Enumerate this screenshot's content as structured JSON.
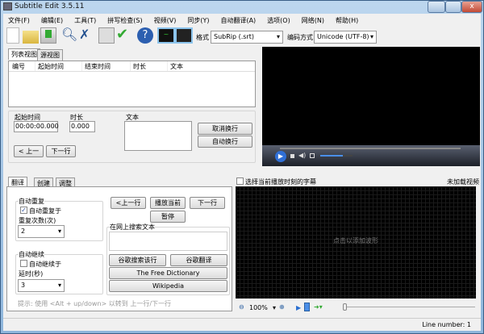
{
  "window": {
    "title": "Subtitle Edit 3.5.11"
  },
  "menu": [
    "文件(F)",
    "编辑(E)",
    "工具(T)",
    "拼写检查(S)",
    "视频(V)",
    "同步(Y)",
    "自动翻译(A)",
    "选项(O)",
    "网络(N)",
    "帮助(H)"
  ],
  "toolbar": {
    "format_label": "格式",
    "format_value": "SubRip (.srt)",
    "encoding_label": "编码方式",
    "encoding_value": "Unicode (UTF-8)"
  },
  "list": {
    "tabs": [
      "列表视图",
      "源视图"
    ],
    "columns": [
      "编号",
      "起始时间",
      "结束时间",
      "时长",
      "文本"
    ]
  },
  "edit": {
    "start_label": "起始时间",
    "start_value": "00:00:00.000",
    "duration_label": "时长",
    "duration_value": "0.000",
    "text_label": "文本",
    "unbreak": "取消换行",
    "autobreak": "自动换行",
    "prev": "< 上一",
    "next": "下一行"
  },
  "bottom": {
    "tabs": [
      "翻译",
      "创建",
      "调整"
    ],
    "auto_repeat": {
      "title": "自动重复",
      "checkbox": "自动重复于",
      "count_label": "重复次数(次)",
      "count_value": "2"
    },
    "auto_continue": {
      "title": "自动继续",
      "checkbox": "自动继续于",
      "delay_label": "延时(秒)",
      "delay_value": "3"
    },
    "prev_line": "<上一行",
    "play_current": "播放当前",
    "next_line": "下一行",
    "pause": "暂停",
    "search_title": "在网上搜索文本",
    "google_search": "谷歌搜索该行",
    "google_translate": "谷歌翻译",
    "free_dictionary": "The Free Dictionary",
    "wikipedia": "Wikipedia",
    "hint": "提示: 使用 <Alt + up/down> 以转到 上一行/下一行"
  },
  "waveform": {
    "select_current": "选择当前播放时刻的字幕",
    "no_video": "未加载视频",
    "click_hint": "点击以添加波形",
    "zoom": "100%"
  },
  "video": {
    "volume": 0.7
  },
  "status": {
    "line_number": "Line number: 1"
  }
}
